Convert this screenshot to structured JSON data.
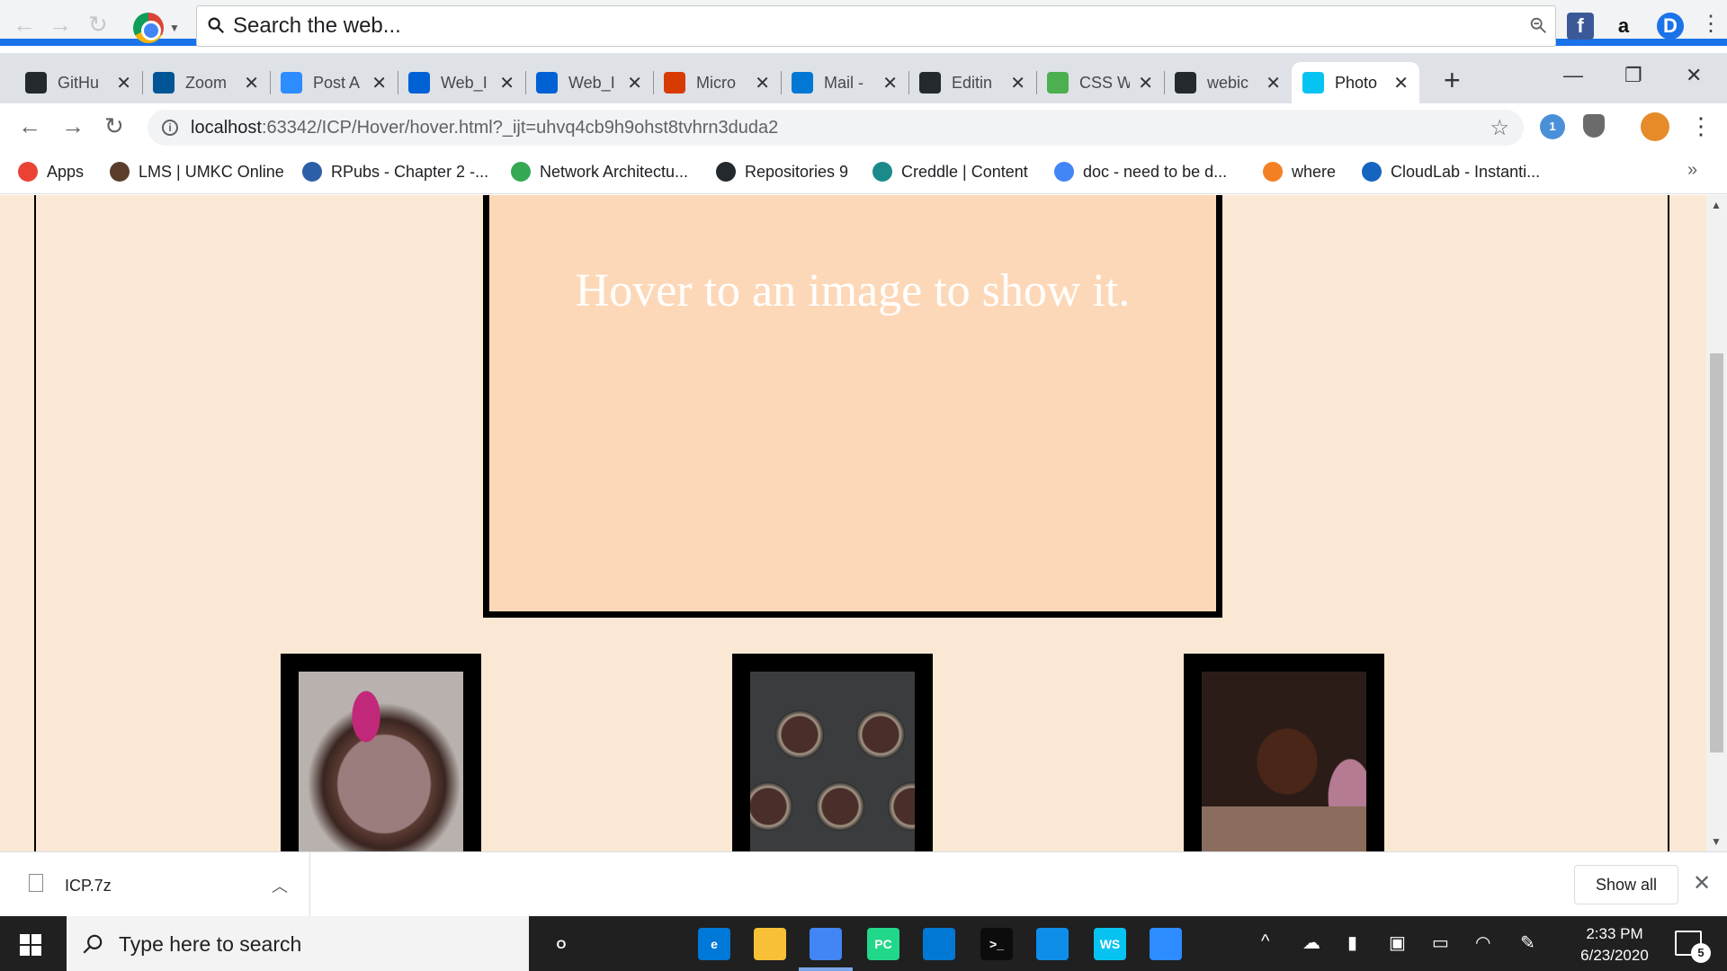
{
  "search_toolbar": {
    "placeholder": "Search the web...",
    "colors": {
      "accent": "#1a73e8"
    }
  },
  "tabs": [
    {
      "title": "GitHu",
      "icon": "github-icon",
      "color": "#24292e"
    },
    {
      "title": "Zoom",
      "icon": "umkc-icon",
      "color": "#005596"
    },
    {
      "title": "Post A",
      "icon": "zoom-icon",
      "color": "#2d8cff"
    },
    {
      "title": "Web_I",
      "icon": "box-icon",
      "color": "#0061d5"
    },
    {
      "title": "Web_I",
      "icon": "box-icon",
      "color": "#0061d5"
    },
    {
      "title": "Micro",
      "icon": "office-icon",
      "color": "#d83b01"
    },
    {
      "title": "Mail -",
      "icon": "outlook-icon",
      "color": "#0078d4"
    },
    {
      "title": "Editin",
      "icon": "github-icon",
      "color": "#24292e"
    },
    {
      "title": "CSS W",
      "icon": "w3schools-icon",
      "color": "#4caf50"
    },
    {
      "title": "webic",
      "icon": "github-icon",
      "color": "#24292e"
    },
    {
      "title": "Photo",
      "icon": "webstorm-icon",
      "color": "#07c3f2",
      "active": true
    }
  ],
  "address_bar": {
    "url_host": "localhost",
    "url_rest": ":63342/ICP/Hover/hover.html?_ijt=uhvq4cb9h9ohst8tvhrn3duda2"
  },
  "bookmarks": [
    {
      "label": "Apps",
      "icon": "apps-grid-icon",
      "color": "#ea4335"
    },
    {
      "label": "LMS | UMKC Online",
      "icon": "umkc-roo-icon",
      "color": "#5a3e2b"
    },
    {
      "label": "RPubs - Chapter 2 -...",
      "icon": "rpubs-icon",
      "color": "#2d5fa8"
    },
    {
      "label": "Network Architectu...",
      "icon": "google-drive-icon",
      "color": "#34a853"
    },
    {
      "label": "Repositories 9",
      "icon": "github-icon",
      "color": "#24292e"
    },
    {
      "label": "Creddle | Content",
      "icon": "creddle-icon",
      "color": "#1b8a8a"
    },
    {
      "label": "doc - need to be d...",
      "icon": "google-docs-icon",
      "color": "#4285f4"
    },
    {
      "label": "where",
      "icon": "stackoverflow-icon",
      "color": "#f48024"
    },
    {
      "label": "CloudLab - Instanti...",
      "icon": "cloudlab-icon",
      "color": "#1565c0"
    }
  ],
  "page": {
    "hover_message": "Hover to an image to show it.",
    "colors": {
      "background": "#fbe8d4",
      "box": "#fdd8b8",
      "text": "#ffffff",
      "border": "#000000"
    }
  },
  "downloads": {
    "file_name": "ICP.7z",
    "show_all_label": "Show all"
  },
  "taskbar": {
    "search_placeholder": "Type here to search",
    "time": "2:33 PM",
    "date": "6/23/2020",
    "notification_count": "5",
    "pinned": [
      {
        "icon": "cortana-icon",
        "label": "O"
      },
      {
        "icon": "task-view-icon",
        "label": ""
      },
      {
        "icon": "edge-icon",
        "label": "e",
        "color": "#0078d7"
      },
      {
        "icon": "file-explorer-icon",
        "label": "",
        "color": "#f8c037"
      },
      {
        "icon": "chrome-icon",
        "label": "",
        "color": "#4285f4",
        "active": true
      },
      {
        "icon": "pycharm-icon",
        "label": "PC",
        "color": "#21d789"
      },
      {
        "icon": "vscode-icon",
        "label": "",
        "color": "#0078d4"
      },
      {
        "icon": "terminal-icon",
        "label": ">_",
        "color": "#0c0c0c"
      },
      {
        "icon": "teamviewer-icon",
        "label": "",
        "color": "#0e8ee9"
      },
      {
        "icon": "webstorm-icon",
        "label": "WS",
        "color": "#07c3f2"
      },
      {
        "icon": "zoom-icon",
        "label": "",
        "color": "#2d8cff"
      }
    ]
  }
}
